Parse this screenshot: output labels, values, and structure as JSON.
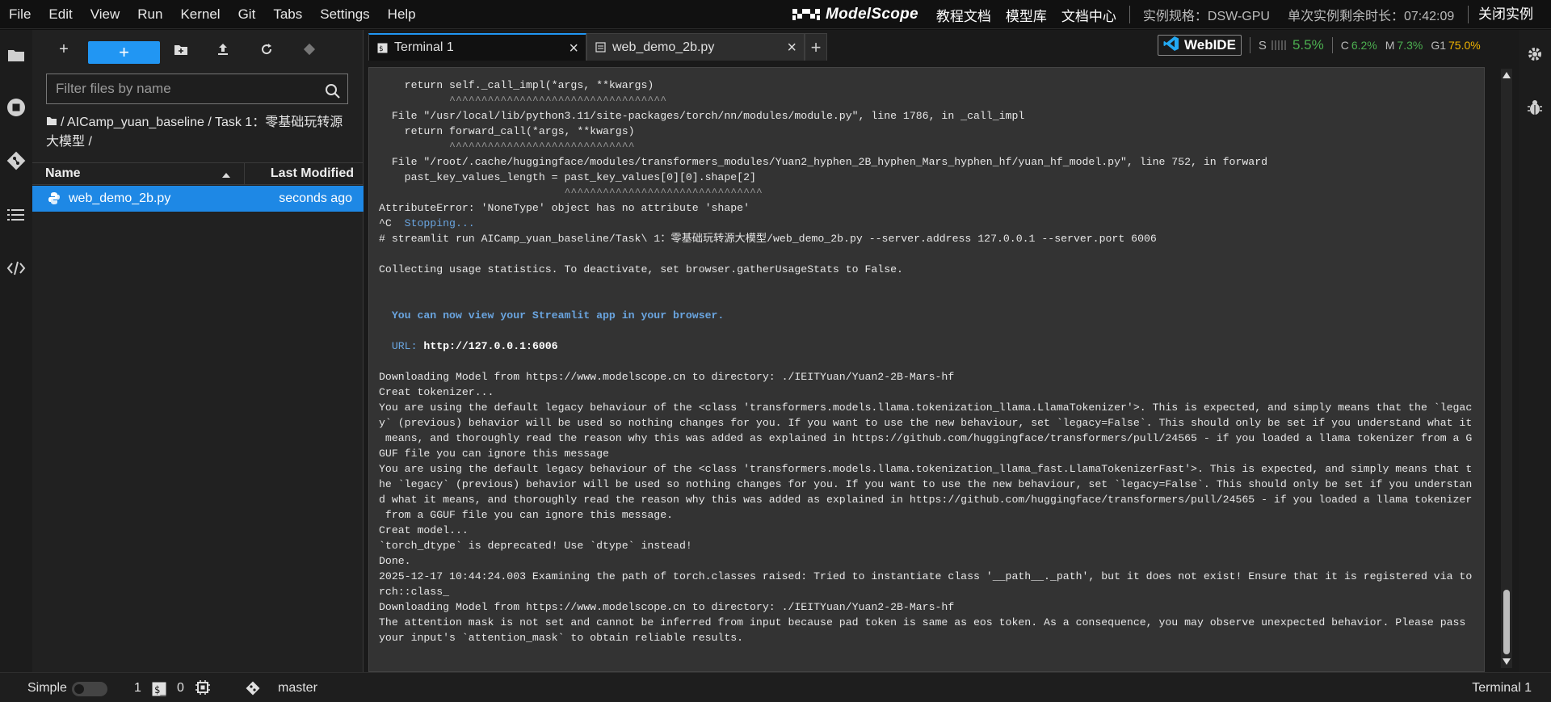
{
  "menubar": {
    "items": [
      "File",
      "Edit",
      "View",
      "Run",
      "Kernel",
      "Git",
      "Tabs",
      "Settings",
      "Help"
    ]
  },
  "brand": {
    "logo_text": "ModelScope",
    "links": [
      "教程文档",
      "模型库",
      "文档中心"
    ],
    "instance_spec": "实例规格：DSW-GPU",
    "remaining_time": "单次实例剩余时长：07:42:09",
    "close_label": "关闭实例"
  },
  "rail_icons": [
    "folder-icon",
    "stop-circle-icon",
    "git-icon",
    "list-icon",
    "code-icon"
  ],
  "right_rail_icons": [
    "gear-icon",
    "bug-icon"
  ],
  "file_browser": {
    "toolbar": [
      "new-file-icon",
      "new-launcher-icon",
      "new-folder-icon",
      "upload-icon",
      "refresh-icon",
      "git-clone-icon"
    ],
    "filter_placeholder": "Filter files by name",
    "breadcrumb": "/ AICamp_yuan_baseline / Task 1：零基础玩转源大模型 /",
    "header": {
      "name": "Name",
      "modified": "Last Modified"
    },
    "files": [
      {
        "name": "web_demo_2b.py",
        "modified": "seconds ago",
        "icon": "python-icon"
      }
    ]
  },
  "tabs": [
    {
      "label": "Terminal 1",
      "icon": "terminal-icon",
      "active": true
    },
    {
      "label": "web_demo_2b.py",
      "icon": "file-icon",
      "active": false
    }
  ],
  "webide": {
    "label": "WebIDE",
    "s_label": "S",
    "s_value": "5.5%",
    "c_label": "C",
    "c_value": "6.2%",
    "m_label": "M",
    "m_value": "7.3%",
    "g_label": "G1",
    "g_value": "75.0%"
  },
  "terminal": {
    "lines": [
      {
        "t": "    return self._call_impl(*args, **kwargs)",
        "c": ""
      },
      {
        "t": "           ^^^^^^^^^^^^^^^^^^^^^^^^^^^^^^^^^^",
        "c": "dim"
      },
      {
        "t": "  File \"/usr/local/lib/python3.11/site-packages/torch/nn/modules/module.py\", line 1786, in _call_impl",
        "c": ""
      },
      {
        "t": "    return forward_call(*args, **kwargs)",
        "c": ""
      },
      {
        "t": "           ^^^^^^^^^^^^^^^^^^^^^^^^^^^^^",
        "c": "dim"
      },
      {
        "t": "  File \"/root/.cache/huggingface/modules/transformers_modules/Yuan2_hyphen_2B_hyphen_Mars_hyphen_hf/yuan_hf_model.py\", line 752, in forward",
        "c": ""
      },
      {
        "t": "    past_key_values_length = past_key_values[0][0].shape[2]",
        "c": ""
      },
      {
        "t": "                             ^^^^^^^^^^^^^^^^^^^^^^^^^^^^^^^",
        "c": "dim"
      },
      {
        "t": "AttributeError: 'NoneType' object has no attribute 'shape'",
        "c": ""
      },
      {
        "t": "^C  Stopping...",
        "c": "stop"
      },
      {
        "t": "# streamlit run AICamp_yuan_baseline/Task\\ 1：零基础玩转源大模型/web_demo_2b.py --server.address 127.0.0.1 --server.port 6006",
        "c": ""
      },
      {
        "t": "",
        "c": ""
      },
      {
        "t": "Collecting usage statistics. To deactivate, set browser.gatherUsageStats to False.",
        "c": ""
      },
      {
        "t": "",
        "c": ""
      },
      {
        "t": "",
        "c": ""
      },
      {
        "t": "  You can now view your Streamlit app in your browser.",
        "c": "blue"
      },
      {
        "t": "",
        "c": ""
      },
      {
        "t": "URL: http://127.0.0.1:6006",
        "c": "url"
      },
      {
        "t": "",
        "c": ""
      },
      {
        "t": "Downloading Model from https://www.modelscope.cn to directory: ./IEITYuan/Yuan2-2B-Mars-hf",
        "c": ""
      },
      {
        "t": "Creat tokenizer...",
        "c": ""
      },
      {
        "t": "You are using the default legacy behaviour of the <class 'transformers.models.llama.tokenization_llama.LlamaTokenizer'>. This is expected, and simply means that the `legac",
        "c": ""
      },
      {
        "t": "y` (previous) behavior will be used so nothing changes for you. If you want to use the new behaviour, set `legacy=False`. This should only be set if you understand what it",
        "c": ""
      },
      {
        "t": " means, and thoroughly read the reason why this was added as explained in https://github.com/huggingface/transformers/pull/24565 - if you loaded a llama tokenizer from a G",
        "c": ""
      },
      {
        "t": "GUF file you can ignore this message",
        "c": ""
      },
      {
        "t": "You are using the default legacy behaviour of the <class 'transformers.models.llama.tokenization_llama_fast.LlamaTokenizerFast'>. This is expected, and simply means that t",
        "c": ""
      },
      {
        "t": "he `legacy` (previous) behavior will be used so nothing changes for you. If you want to use the new behaviour, set `legacy=False`. This should only be set if you understan",
        "c": ""
      },
      {
        "t": "d what it means, and thoroughly read the reason why this was added as explained in https://github.com/huggingface/transformers/pull/24565 - if you loaded a llama tokenizer",
        "c": ""
      },
      {
        "t": " from a GGUF file you can ignore this message.",
        "c": ""
      },
      {
        "t": "Creat model...",
        "c": ""
      },
      {
        "t": "`torch_dtype` is deprecated! Use `dtype` instead!",
        "c": ""
      },
      {
        "t": "Done.",
        "c": ""
      },
      {
        "t": "2025-12-17 10:44:24.003 Examining the path of torch.classes raised: Tried to instantiate class '__path__._path', but it does not exist! Ensure that it is registered via to",
        "c": ""
      },
      {
        "t": "rch::class_",
        "c": ""
      },
      {
        "t": "Downloading Model from https://www.modelscope.cn to directory: ./IEITYuan/Yuan2-2B-Mars-hf",
        "c": ""
      },
      {
        "t": "The attention mask is not set and cannot be inferred from input because pad token is same as eos token. As a consequence, you may observe unexpected behavior. Please pass",
        "c": ""
      },
      {
        "t": "your input's `attention_mask` to obtain reliable results.",
        "c": ""
      }
    ]
  },
  "statusbar": {
    "simple_label": "Simple",
    "terminals_count": "1",
    "kernels_count": "0",
    "branch": "master",
    "active_label": "Terminal 1"
  },
  "colors": {
    "accent": "#2196f3",
    "s_value": "#4caf50",
    "c_value": "#4caf50",
    "m_value": "#4caf50",
    "g_value": "#f0b400",
    "terminal_blue": "#6aa5e0"
  }
}
